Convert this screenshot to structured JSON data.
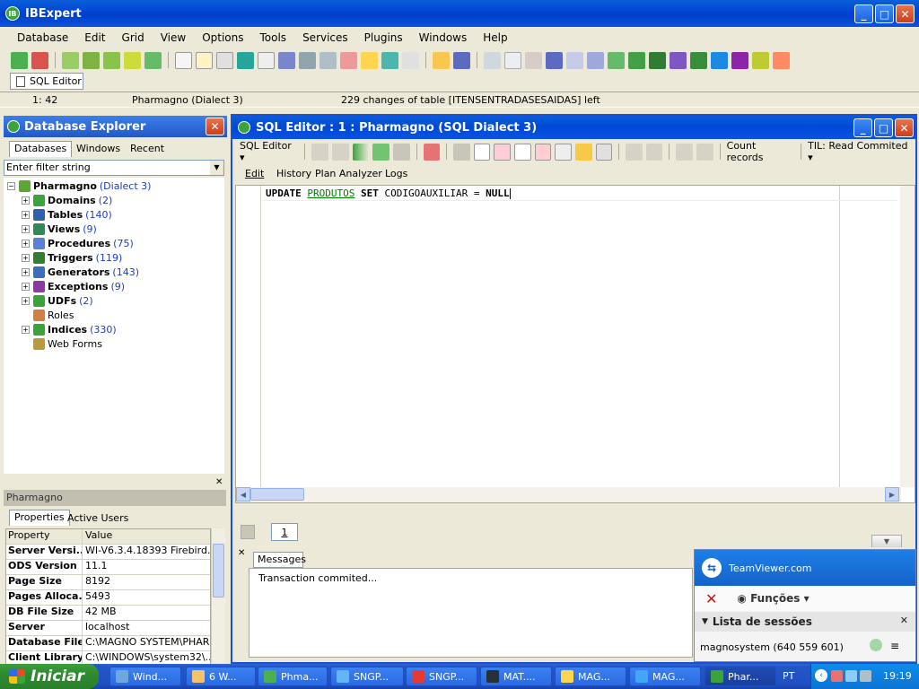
{
  "app": {
    "title": "IBExpert",
    "menu": [
      "Database",
      "Edit",
      "Grid",
      "View",
      "Options",
      "Tools",
      "Services",
      "Plugins",
      "Windows",
      "Help"
    ],
    "doc_tab": "SQL Editor",
    "status": {
      "position": "1:   42",
      "database": "Pharmagno (Dialect 3)",
      "message": "229 changes of table [ITENSENTRADASESAIDAS] left"
    }
  },
  "explorer": {
    "title": "Database Explorer",
    "tabs": [
      "Databases",
      "Windows",
      "Recent"
    ],
    "filter_placeholder": "Enter filter string",
    "root": {
      "name": "Pharmagno",
      "dialect": "(Dialect 3)"
    },
    "nodes": [
      {
        "label": "Domains",
        "count": "(2)",
        "icon": "domain-icon",
        "color": "#3aa33a"
      },
      {
        "label": "Tables",
        "count": "(140)",
        "icon": "table-icon",
        "color": "#2f5fb0"
      },
      {
        "label": "Views",
        "count": "(9)",
        "icon": "view-icon",
        "color": "#2e8b57"
      },
      {
        "label": "Procedures",
        "count": "(75)",
        "icon": "procedure-icon",
        "color": "#5a7fd6"
      },
      {
        "label": "Triggers",
        "count": "(119)",
        "icon": "trigger-icon",
        "color": "#2f7f2f"
      },
      {
        "label": "Generators",
        "count": "(143)",
        "icon": "generator-icon",
        "color": "#3a6fbf"
      },
      {
        "label": "Exceptions",
        "count": "(9)",
        "icon": "exception-icon",
        "color": "#8b3aa3"
      },
      {
        "label": "UDFs",
        "count": "(2)",
        "icon": "udf-icon",
        "color": "#3aa33a"
      },
      {
        "label": "Roles",
        "count": "",
        "icon": "role-icon",
        "color": "#d08040"
      },
      {
        "label": "Indices",
        "count": "(330)",
        "icon": "index-icon",
        "color": "#3aa33a"
      },
      {
        "label": "Web Forms",
        "count": "",
        "icon": "webform-icon",
        "color": "#b89a3a"
      }
    ],
    "props_title": "Pharmagno",
    "props_tabs": [
      "Properties",
      "Active Users"
    ],
    "props_header": {
      "k": "Property",
      "v": "Value"
    },
    "props": [
      {
        "k": "Server Versi...",
        "v": "WI-V6.3.4.18393 Firebird..."
      },
      {
        "k": "ODS Version",
        "v": "11.1"
      },
      {
        "k": "Page Size",
        "v": "8192"
      },
      {
        "k": "Pages Alloca...",
        "v": "5493"
      },
      {
        "k": "DB File Size",
        "v": "42 MB"
      },
      {
        "k": "Server",
        "v": "localhost"
      },
      {
        "k": "Database File",
        "v": "C:\\MAGNO SYSTEM\\PHAR..."
      },
      {
        "k": "Client Library",
        "v": "C:\\WINDOWS\\system32\\..."
      }
    ]
  },
  "sql": {
    "title": "SQL Editor : 1 : Pharmagno (SQL Dialect 3)",
    "editor_btn": "SQL Editor",
    "count_records": "Count records",
    "til": "TIL: Read Commited",
    "tabs": [
      "Edit",
      "History",
      "Plan Analyzer",
      "Logs"
    ],
    "code": {
      "kw1": "UPDATE",
      "table": "PRODUTOS",
      "kw2": "SET",
      "rest": "CODIGOAUXILIAR",
      "eq": "=",
      "kw3": "NULL"
    },
    "page": "1",
    "messages_tab": "Messages",
    "message": "Transaction commited..."
  },
  "teamviewer": {
    "brand": "TeamViewer.com",
    "functions": "Funções",
    "sessions_title": "Lista de sessões",
    "session": "magnosystem (640 559 601)"
  },
  "taskbar": {
    "start": "Iniciar",
    "items": [
      "Wind...",
      "6 W...",
      "Phma...",
      "SNGP...",
      "SNGP...",
      "MAT....",
      "MAG...",
      "MAG...",
      "Phar..."
    ],
    "lang": "PT",
    "clock": "19:19"
  }
}
